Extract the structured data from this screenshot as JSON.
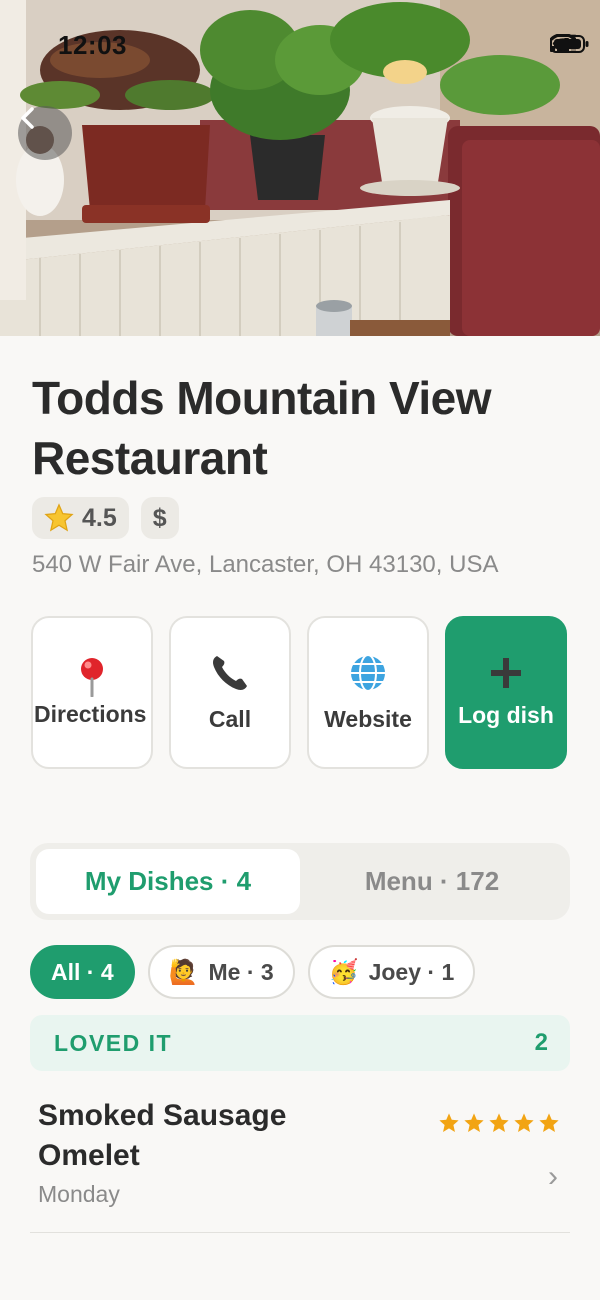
{
  "status_bar": {
    "time": "12:03"
  },
  "restaurant": {
    "name": "Todds Mountain View Restaurant",
    "rating": "4.5",
    "price": "$",
    "address": "540 W Fair Ave, Lancaster, OH 43130, USA"
  },
  "actions": [
    {
      "label": "Directions",
      "icon": "pin-icon"
    },
    {
      "label": "Call",
      "icon": "phone-icon"
    },
    {
      "label": "Website",
      "icon": "globe-icon"
    },
    {
      "label": "Log dish",
      "icon": "plus-icon"
    }
  ],
  "tabs": [
    {
      "label": "My Dishes · 4",
      "active": true
    },
    {
      "label": "Menu · 172",
      "active": false
    }
  ],
  "filters": [
    {
      "label": "All · 4",
      "icon": "",
      "active": true
    },
    {
      "label": "Me · 3",
      "icon": "🙋",
      "active": false
    },
    {
      "label": "Joey · 1",
      "icon": "🥳",
      "active": false
    }
  ],
  "section": {
    "title": "LOVED IT",
    "count": "2"
  },
  "dishes": [
    {
      "name": "Smoked Sausage Omelet",
      "date": "Monday",
      "rating": 5
    }
  ],
  "colors": {
    "accent": "#1f9d6e",
    "star": "#f2a413",
    "background": "#f9f8f6"
  }
}
